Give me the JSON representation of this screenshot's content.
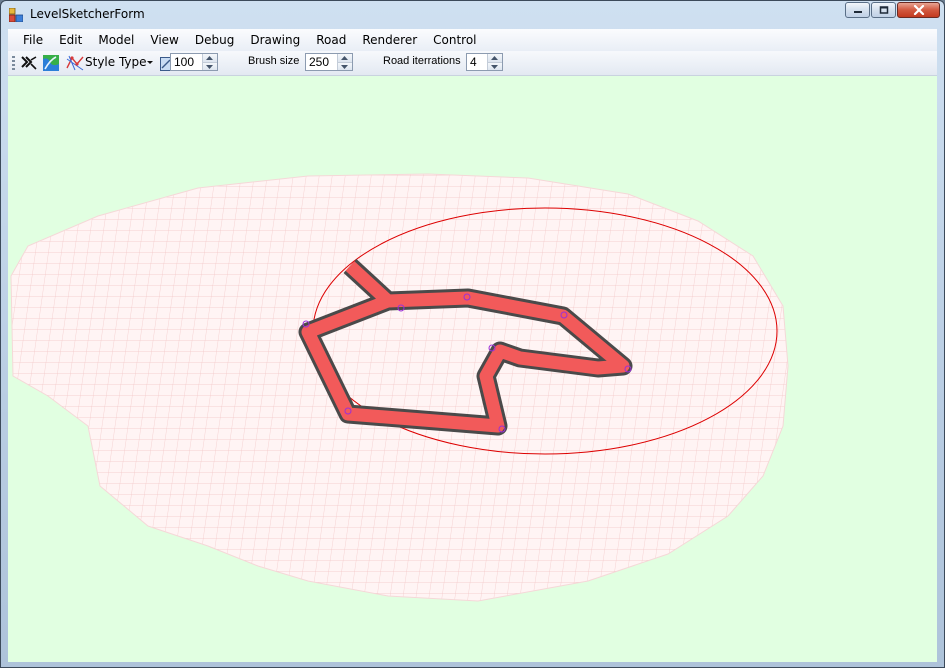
{
  "window": {
    "title": "LevelSketcherForm"
  },
  "menu": {
    "items": [
      "File",
      "Edit",
      "Model",
      "View",
      "Debug",
      "Drawing",
      "Road",
      "Renderer",
      "Control"
    ]
  },
  "toolbar": {
    "style_type_label": "Style Type",
    "zoom_value": "100",
    "brush_size_label": "Brush size",
    "brush_size_value": "250",
    "road_iterations_label": "Road iterrations",
    "road_iterations_value": "4"
  },
  "icons": {
    "app": "app-icon",
    "select": "select-tool-icon",
    "brush": "terrain-brush-icon",
    "style": "style-type-icon",
    "zoom": "zoom-icon",
    "minimize": "minimize-icon",
    "maximize": "maximize-icon",
    "close": "close-icon"
  },
  "colors": {
    "viewport_background": "#e1ffe1",
    "terrain": "#fff4f4",
    "grid": "#f0b8b8",
    "road_fill": "#f25a5a",
    "road_border": "#4a4a4a",
    "selection_circle": "#dd0000",
    "control_point": "#9b30d8"
  }
}
